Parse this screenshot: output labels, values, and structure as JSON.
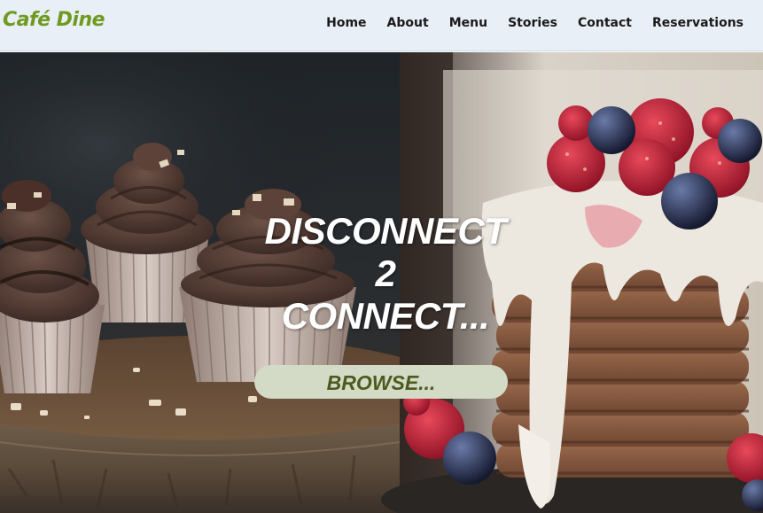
{
  "header": {
    "brand": "Café Dine",
    "nav": [
      {
        "label": "Home"
      },
      {
        "label": "About"
      },
      {
        "label": "Menu"
      },
      {
        "label": "Stories"
      },
      {
        "label": "Contact"
      },
      {
        "label": "Reservations"
      }
    ]
  },
  "hero": {
    "title_line1": "DISCONNECT",
    "title_line2": "2",
    "title_line3": "CONNECT...",
    "browse_label": "BROWSE...",
    "left_image": "chocolate cupcakes on wooden board",
    "right_image": "pancake stack with berries and cream"
  },
  "colors": {
    "navbar_bg": "#e8eff6",
    "brand": "#6f9a1f",
    "button_bg": "#d3dbc6",
    "button_text": "#4d5a1e"
  }
}
